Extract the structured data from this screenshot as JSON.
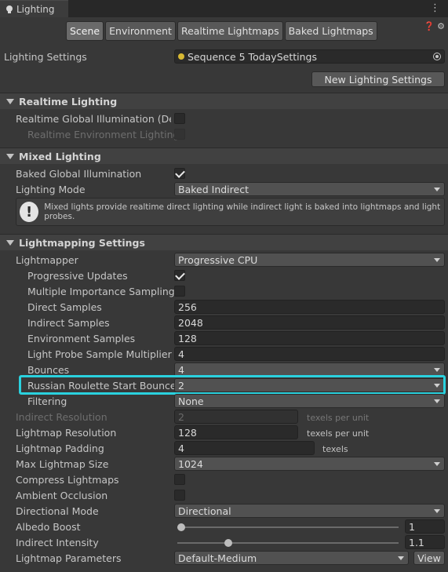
{
  "window": {
    "tab_title": "Lighting",
    "menu_icon": "kebab-menu-icon"
  },
  "tabs": [
    "Scene",
    "Environment",
    "Realtime Lightmaps",
    "Baked Lightmaps"
  ],
  "active_tab": "Scene",
  "lighting_settings": {
    "label": "Lighting Settings",
    "asset": "Sequence 5 TodaySettings",
    "new_button": "New Lighting Settings"
  },
  "realtime": {
    "title": "Realtime Lighting",
    "gi_label": "Realtime Global Illumination (Deprecated)",
    "env_label": "Realtime Environment Lighting"
  },
  "mixed": {
    "title": "Mixed Lighting",
    "baked_gi_label": "Baked Global Illumination",
    "mode_label": "Lighting Mode",
    "mode_value": "Baked Indirect",
    "info_icon": "!",
    "info_text": "Mixed lights provide realtime direct lighting while indirect light is baked into lightmaps and light probes."
  },
  "lightmapping": {
    "title": "Lightmapping Settings",
    "lightmapper_label": "Lightmapper",
    "lightmapper_value": "Progressive CPU",
    "progressive_updates": "Progressive Updates",
    "mis": "Multiple Importance Sampling",
    "direct_samples_label": "Direct Samples",
    "direct_samples": "256",
    "indirect_samples_label": "Indirect Samples",
    "indirect_samples": "2048",
    "env_samples_label": "Environment Samples",
    "env_samples": "128",
    "lp_mult_label": "Light Probe Sample Multiplier",
    "lp_mult": "4",
    "bounces_label": "Bounces",
    "bounces": "4",
    "rr_label": "Russian Roulette Start Bounce",
    "rr": "2",
    "filtering_label": "Filtering",
    "filtering": "None",
    "indirect_res_label": "Indirect Resolution",
    "indirect_res": "2",
    "indirect_res_unit": "texels per unit",
    "lightmap_res_label": "Lightmap Resolution",
    "lightmap_res": "128",
    "lightmap_res_unit": "texels per unit",
    "padding_label": "Lightmap Padding",
    "padding": "4",
    "padding_unit": "texels",
    "max_size_label": "Max Lightmap Size",
    "max_size": "1024",
    "compress_label": "Compress Lightmaps",
    "ao_label": "Ambient Occlusion",
    "dir_mode_label": "Directional Mode",
    "dir_mode": "Directional",
    "albedo_label": "Albedo Boost",
    "albedo": "1",
    "albedo_level": 0.0,
    "indirect_int_label": "Indirect Intensity",
    "indirect_int": "1.1",
    "indirect_int_level": 0.22,
    "params_label": "Lightmap Parameters",
    "params": "Default-Medium",
    "view_button": "View"
  }
}
